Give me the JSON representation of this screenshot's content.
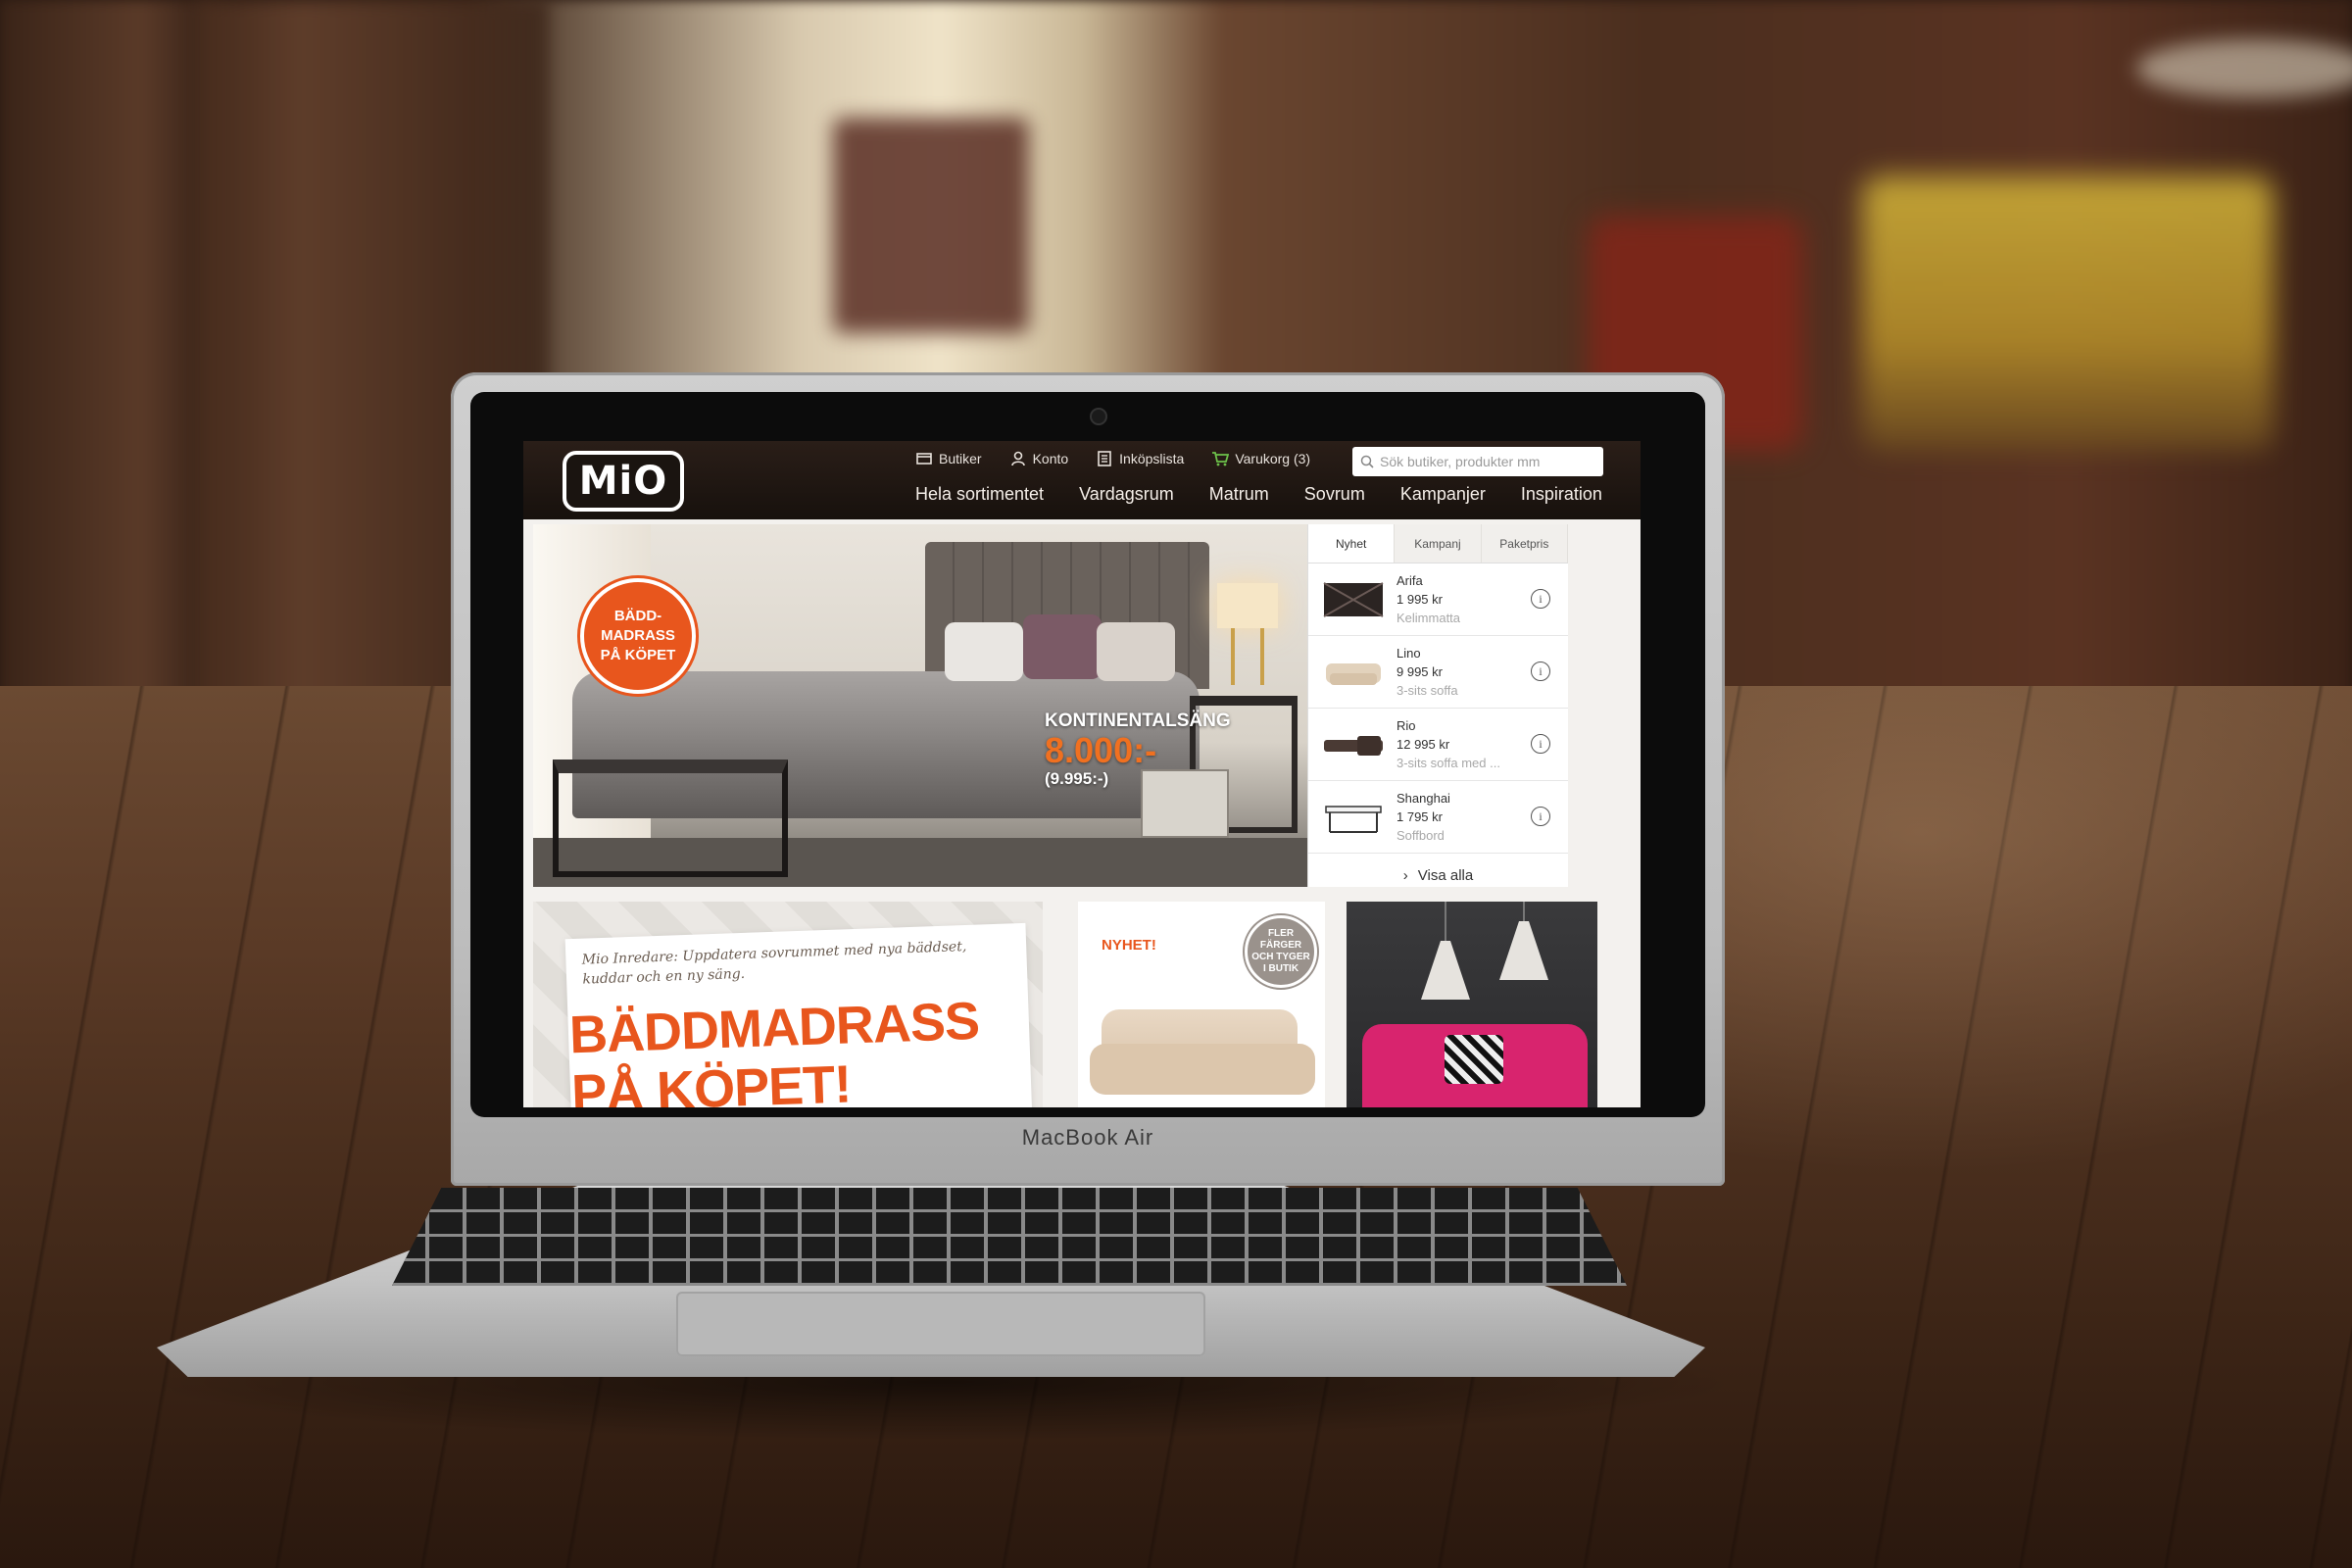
{
  "laptop": {
    "model_label": "MacBook Air"
  },
  "site": {
    "logo_text": "MiO",
    "utility": {
      "stores": "Butiker",
      "account": "Konto",
      "shopping_list": "Inköpslista",
      "cart": "Varukorg (3)"
    },
    "search": {
      "placeholder": "Sök butiker, produkter mm"
    },
    "nav": [
      "Hela sortimentet",
      "Vardagsrum",
      "Matrum",
      "Sovrum",
      "Kampanjer",
      "Inspiration"
    ],
    "hero": {
      "badge_line1": "BÄDD-",
      "badge_line2": "MADRASS",
      "badge_line3": "PÅ KÖPET",
      "product_title": "KONTINENTALSÄNG",
      "price_now": "8.000:-",
      "price_was": "(9.995:-)"
    },
    "panel": {
      "tabs": [
        "Nyhet",
        "Kampanj",
        "Paketpris"
      ],
      "active_tab": "Nyhet",
      "products": [
        {
          "name": "Arifa",
          "price": "1 995 kr",
          "category": "Kelimmatta"
        },
        {
          "name": "Lino",
          "price": "9 995 kr",
          "category": "3-sits soffa"
        },
        {
          "name": "Rio",
          "price": "12 995 kr",
          "category": "3-sits soffa med ..."
        },
        {
          "name": "Shanghai",
          "price": "1 795 kr",
          "category": "Soffbord"
        }
      ],
      "show_all": "Visa alla"
    },
    "tile1": {
      "intro": "Mio Inredare: Uppdatera sovrummet med nya bäddset, kuddar och en ny säng.",
      "headline_line1": "BÄDDMADRASS",
      "headline_line2": "PÅ KÖPET!"
    },
    "tile2": {
      "new_label": "NYHET!",
      "circle_line1": "FLER",
      "circle_line2": "FÄRGER",
      "circle_line3": "OCH TYGER",
      "circle_line4": "I BUTIK"
    },
    "colors": {
      "brand_orange": "#e8561d",
      "header_dark": "#1c1410"
    }
  }
}
